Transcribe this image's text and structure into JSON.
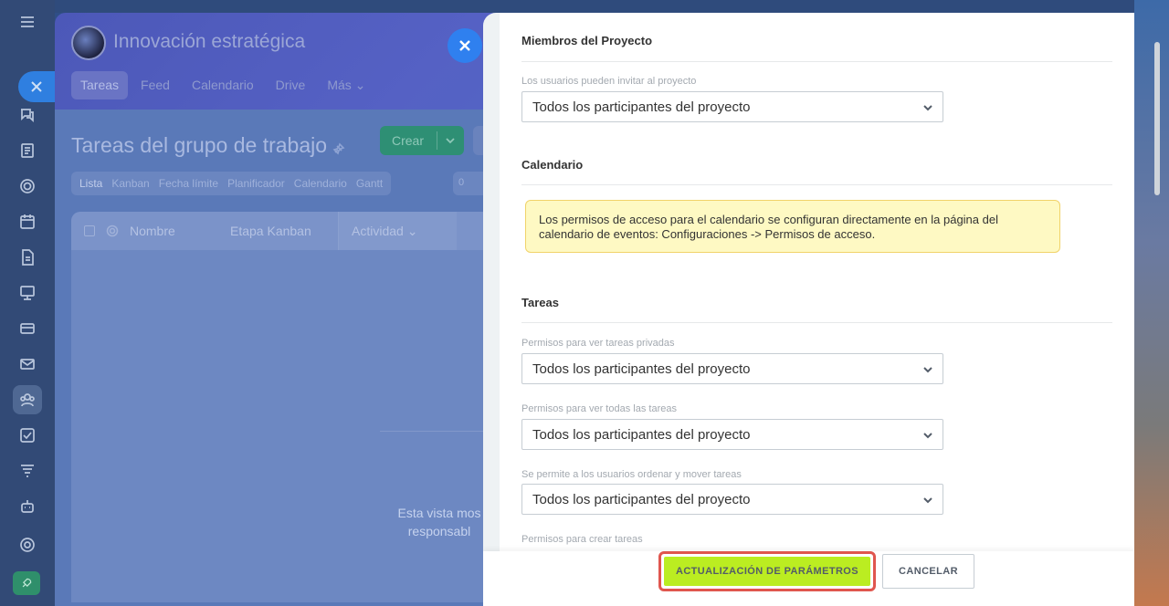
{
  "background_page": {
    "group_title": "Innovación estratégica",
    "tabs": [
      {
        "label": "Tareas",
        "selected": true
      },
      {
        "label": "Feed",
        "selected": false
      },
      {
        "label": "Calendario",
        "selected": false
      },
      {
        "label": "Drive",
        "selected": false
      },
      {
        "label": "Más",
        "selected": false
      }
    ],
    "page_title": "Tareas del grupo de trabajo",
    "create_label": "Crear",
    "views": [
      "Lista",
      "Kanban",
      "Fecha límite",
      "Planificador",
      "Calendario",
      "Gantt"
    ],
    "counter_text": "0",
    "columns": [
      "Nombre",
      "Etapa Kanban",
      "Actividad"
    ],
    "empty_text": "Esta vista mos responsabl"
  },
  "settings": {
    "sections": {
      "members_title": "Miembros del Proyecto",
      "calendar_title": "Calendario",
      "tasks_title": "Tareas"
    },
    "fields": {
      "invite": {
        "label": "Los usuarios pueden invitar al proyecto",
        "value": "Todos los participantes del proyecto"
      },
      "view_private": {
        "label": "Permisos para ver tareas privadas",
        "value": "Todos los participantes del proyecto"
      },
      "view_all": {
        "label": "Permisos para ver todas las tareas",
        "value": "Todos los participantes del proyecto"
      },
      "sort_move": {
        "label": "Se permite a los usuarios ordenar y mover tareas",
        "value": "Todos los participantes del proyecto"
      },
      "create": {
        "label": "Permisos para crear tareas"
      }
    },
    "calendar_notice": "Los permisos de acceso para el calendario se configuran directamente en la página del calendario de eventos: Configuraciones -> Permisos de acceso.",
    "footer": {
      "save_label": "ACTUALIZACIÓN DE PARÁMETROS",
      "cancel_label": "CANCELAR"
    }
  },
  "colors": {
    "save_button": "#bbed21",
    "highlight_border": "#e0564e",
    "notice_background": "#fef9c3"
  }
}
